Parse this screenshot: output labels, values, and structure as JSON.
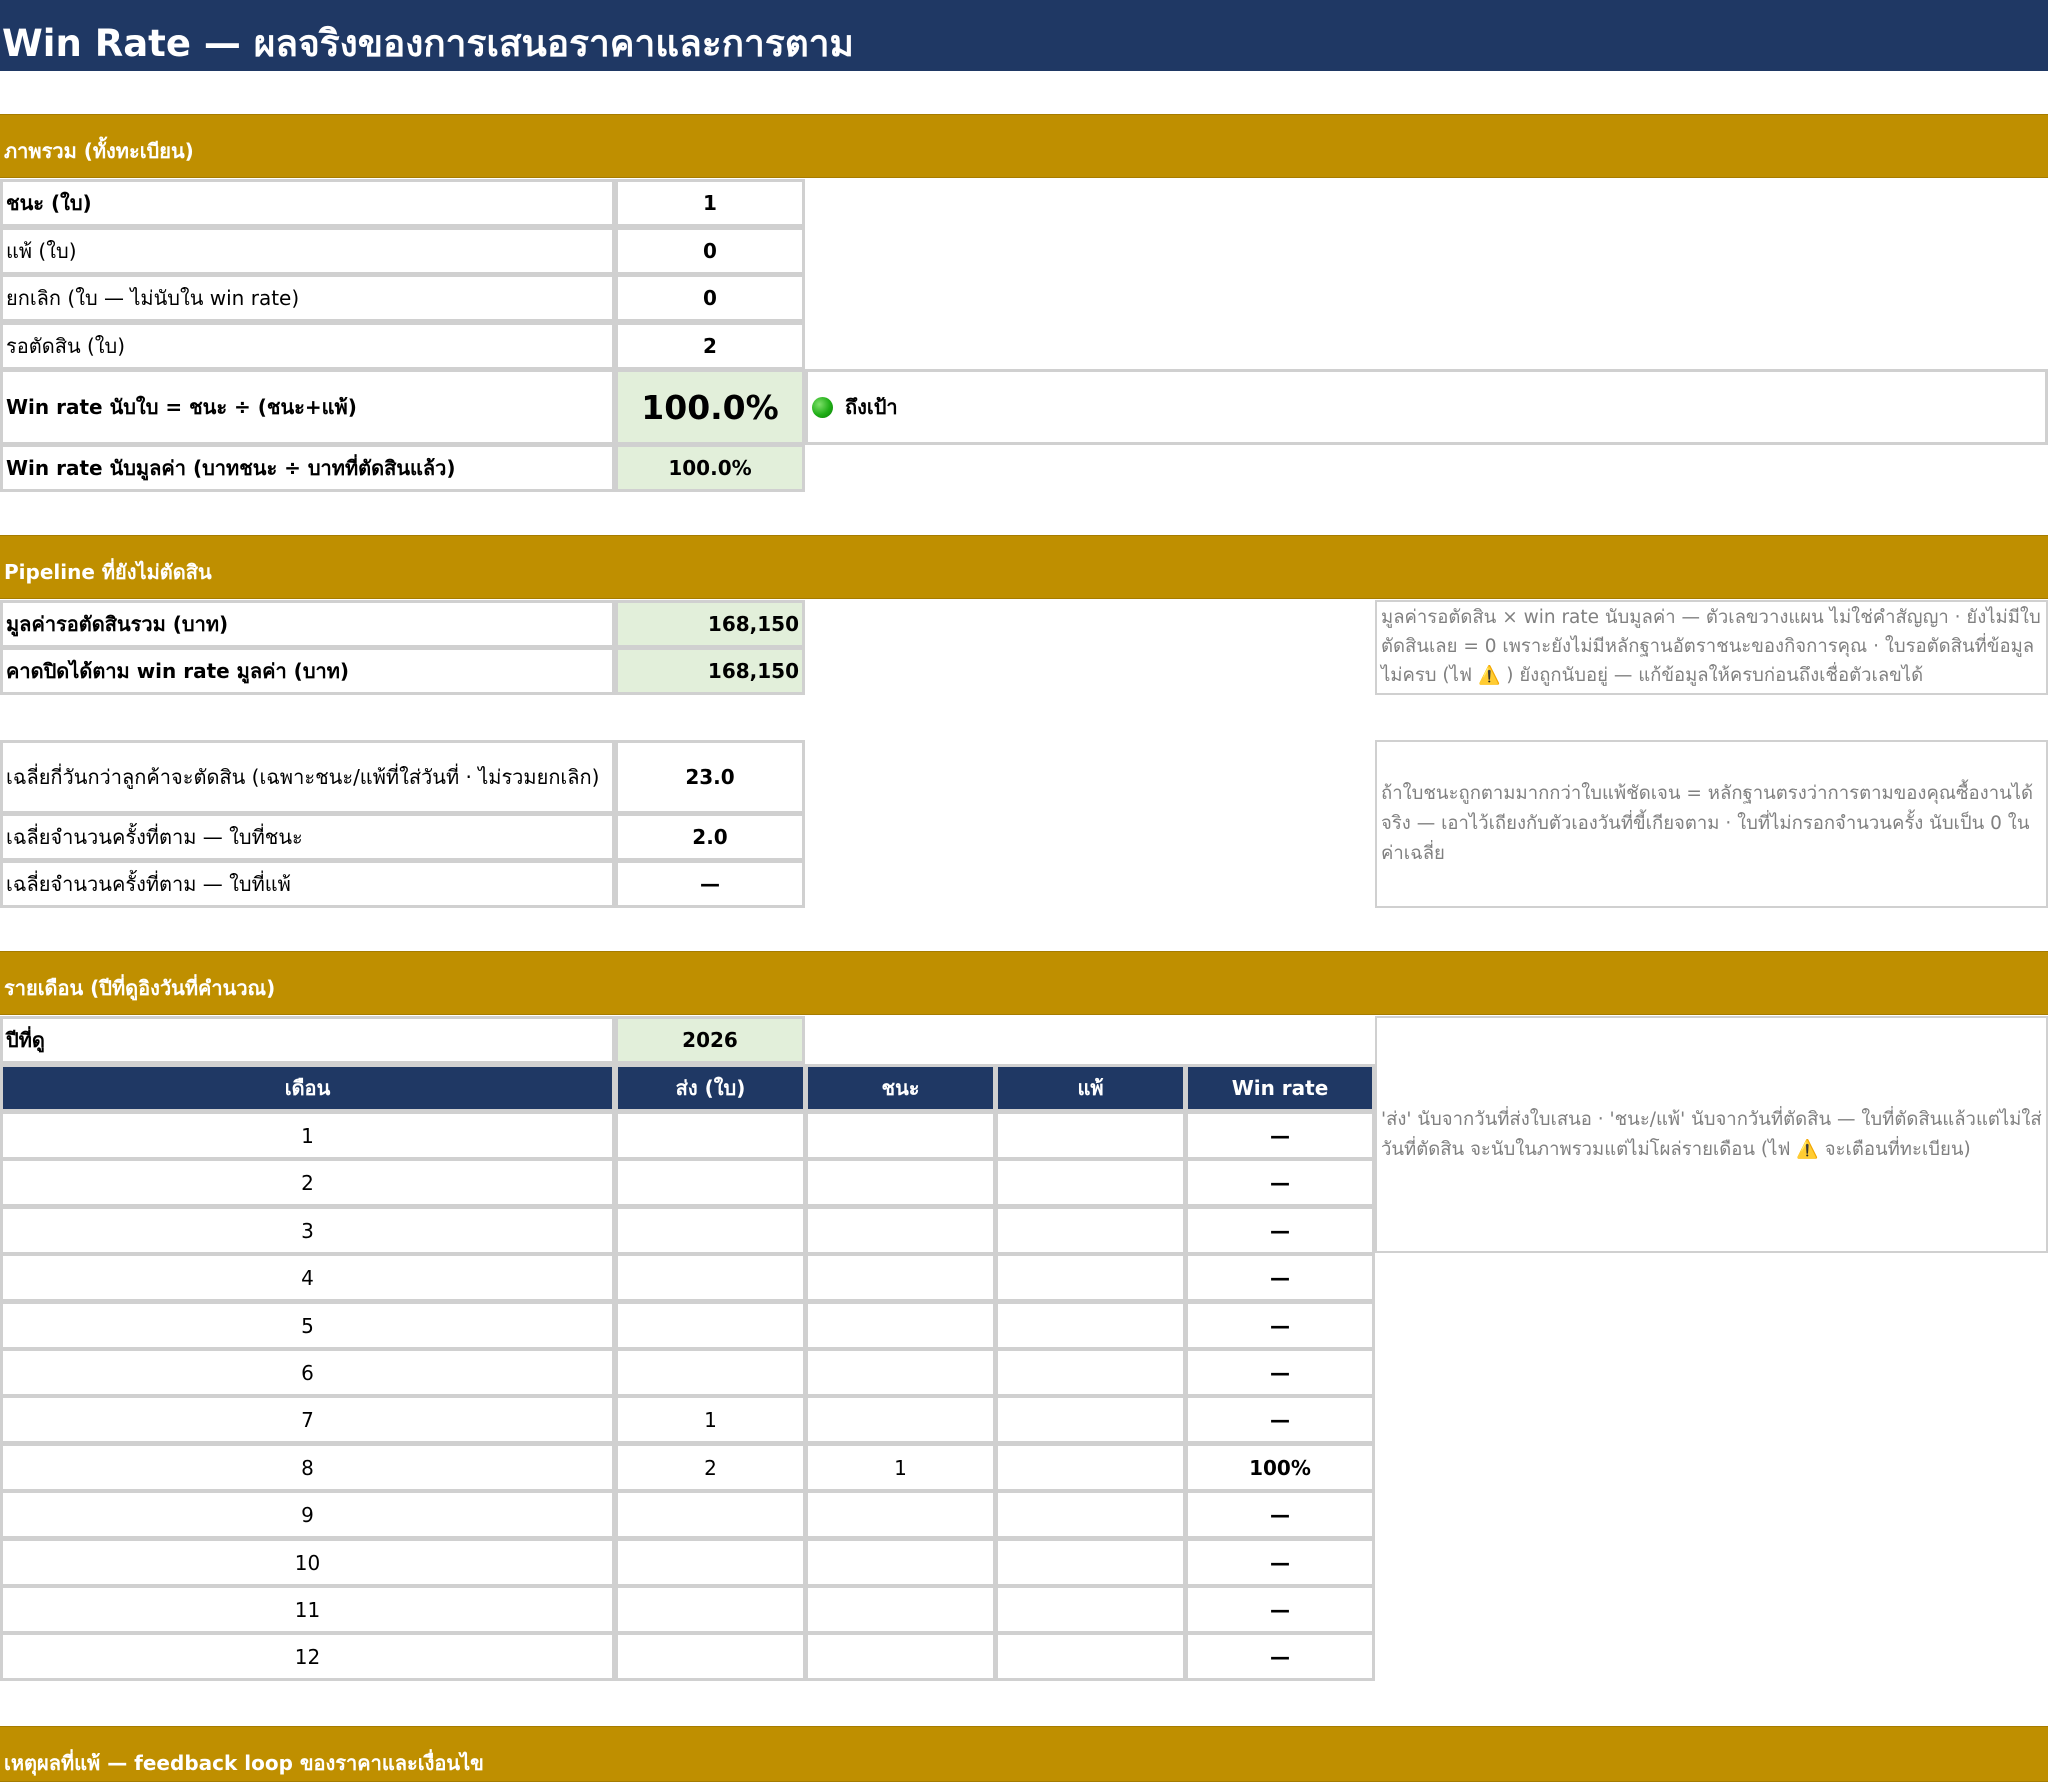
{
  "title": "Win Rate — ผลจริงของการเสนอราคาและการตาม",
  "overview": {
    "header": "ภาพรวม (ทั้งทะเบียน)",
    "rows": [
      {
        "label": "ชนะ (ใบ)",
        "value": "1"
      },
      {
        "label": "แพ้ (ใบ)",
        "value": "0"
      },
      {
        "label": "ยกเลิก (ใบ — ไม่นับใน win rate)",
        "value": "0"
      },
      {
        "label": "รอตัดสิน (ใบ)",
        "value": "2"
      }
    ],
    "win_rate_count_label": "Win rate นับใบ = ชนะ ÷ (ชนะ+แพ้)",
    "win_rate_count_value": "100.0%",
    "status_text": "ถึงเป้า",
    "win_rate_value_label": "Win rate นับมูลค่า (บาทชนะ ÷ บาทที่ตัดสินแล้ว)",
    "win_rate_value_value": "100.0%"
  },
  "pipeline": {
    "header": "Pipeline ที่ยังไม่ตัดสิน",
    "rows": [
      {
        "label": "มูลค่ารอตัดสินรวม (บาท)",
        "value": "168,150"
      },
      {
        "label": "คาดปิดได้ตาม win rate มูลค่า (บาท)",
        "value": "168,150"
      }
    ],
    "note_before_icon": "มูลค่ารอตัดสิน × win rate นับมูลค่า — ตัวเลขวางแผน ไม่ใช่คำสัญญา · ยังไม่มีใบตัดสินเลย = 0 เพราะยังไม่มีหลักฐานอัตราชนะของกิจการคุณ · ใบรอตัดสินที่ข้อมูลไม่ครบ (ไฟ ",
    "note_icon": "⚠️",
    "note_after_icon": " ) ยังถูกนับอยู่ — แก้ข้อมูลให้ครบก่อนถึงเชื่อตัวเลขได้"
  },
  "followup": {
    "rows": [
      {
        "label": "เฉลี่ยกี่วันกว่าลูกค้าจะตัดสิน (เฉพาะชนะ/แพ้ที่ใส่วันที่ · ไม่รวมยกเลิก)",
        "value": "23.0"
      },
      {
        "label": "เฉลี่ยจำนวนครั้งที่ตาม — ใบที่ชนะ",
        "value": "2.0"
      },
      {
        "label": "เฉลี่ยจำนวนครั้งที่ตาม — ใบที่แพ้",
        "value": "—"
      }
    ],
    "note": "ถ้าใบชนะถูกตามมากกว่าใบแพ้ชัดเจน = หลักฐานตรงว่าการตามของคุณซื้องานได้จริง — เอาไว้เถียงกับตัวเองวันที่ขี้เกียจตาม · ใบที่ไม่กรอกจำนวนครั้ง นับเป็น 0 ในค่าเฉลี่ย"
  },
  "monthly": {
    "header": "รายเดือน (ปีที่ดูอิงวันที่คำนวณ)",
    "year_label": "ปีที่ดู",
    "year_value": "2026",
    "columns": [
      "เดือน",
      "ส่ง (ใบ)",
      "ชนะ",
      "แพ้",
      "Win rate"
    ],
    "rows": [
      {
        "month": "1",
        "sent": "",
        "won": "",
        "lost": "",
        "rate": "—"
      },
      {
        "month": "2",
        "sent": "",
        "won": "",
        "lost": "",
        "rate": "—"
      },
      {
        "month": "3",
        "sent": "",
        "won": "",
        "lost": "",
        "rate": "—"
      },
      {
        "month": "4",
        "sent": "",
        "won": "",
        "lost": "",
        "rate": "—"
      },
      {
        "month": "5",
        "sent": "",
        "won": "",
        "lost": "",
        "rate": "—"
      },
      {
        "month": "6",
        "sent": "",
        "won": "",
        "lost": "",
        "rate": "—"
      },
      {
        "month": "7",
        "sent": "1",
        "won": "",
        "lost": "",
        "rate": "—"
      },
      {
        "month": "8",
        "sent": "2",
        "won": "1",
        "lost": "",
        "rate": "100%"
      },
      {
        "month": "9",
        "sent": "",
        "won": "",
        "lost": "",
        "rate": "—"
      },
      {
        "month": "10",
        "sent": "",
        "won": "",
        "lost": "",
        "rate": "—"
      },
      {
        "month": "11",
        "sent": "",
        "won": "",
        "lost": "",
        "rate": "—"
      },
      {
        "month": "12",
        "sent": "",
        "won": "",
        "lost": "",
        "rate": "—"
      }
    ],
    "note_before_icon": "'ส่ง' นับจากวันที่ส่งใบเสนอ · 'ชนะ/แพ้' นับจากวันที่ตัดสิน — ใบที่ตัดสินแล้วแต่ไม่ใส่วันที่ตัดสิน จะนับในภาพรวมแต่ไม่โผล่รายเดือน (ไฟ ",
    "note_icon": "⚠️",
    "note_after_icon": " จะเตือนที่ทะเบียน)"
  },
  "loss_reasons": {
    "header": "เหตุผลที่แพ้ — feedback loop ของราคาและเงื่อนไข"
  },
  "colors": {
    "navy": "#1f3864",
    "gold": "#bf8f00",
    "input_green": "#e2efda",
    "status_green": "#1fae16"
  }
}
